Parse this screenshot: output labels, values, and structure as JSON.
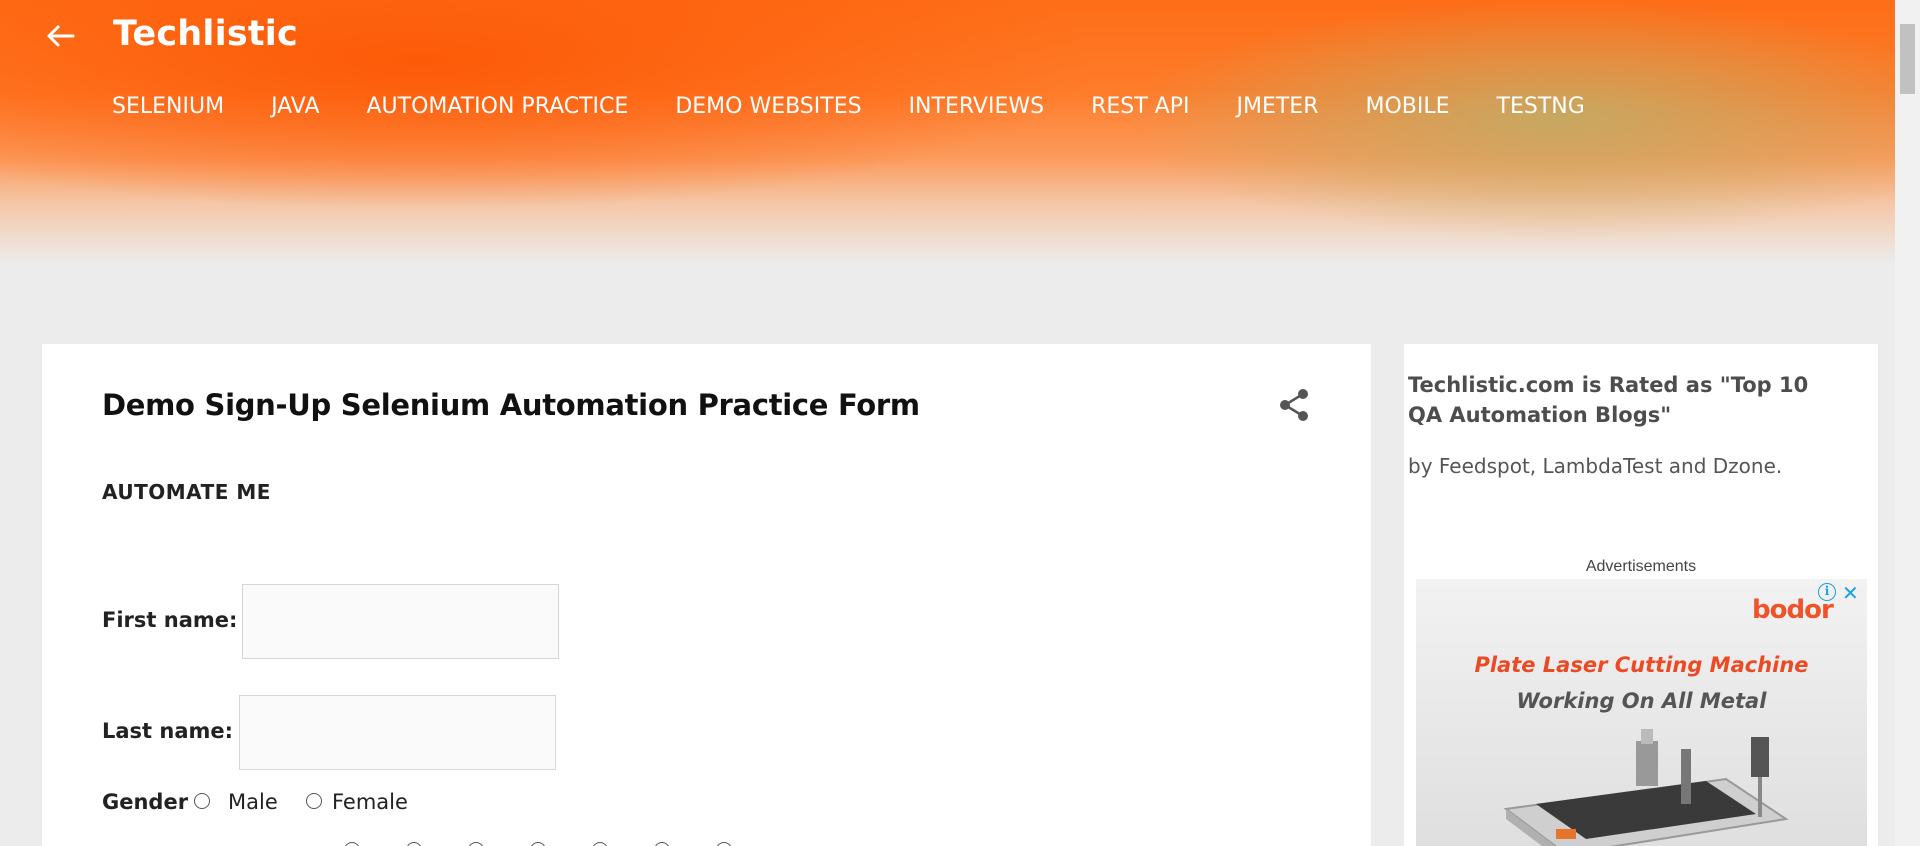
{
  "header": {
    "site_title": "Techlistic",
    "nav_items": [
      "SELENIUM",
      "JAVA",
      "AUTOMATION PRACTICE",
      "DEMO WEBSITES",
      "INTERVIEWS",
      "REST API",
      "JMETER",
      "MOBILE",
      "TESTNG"
    ]
  },
  "post": {
    "title": "Demo Sign-Up Selenium Automation Practice Form",
    "subheading": "AUTOMATE ME",
    "first_name_label": "First name:",
    "first_name_value": "",
    "last_name_label": "Last name:",
    "last_name_value": "",
    "gender_label": "Gender",
    "gender_options": [
      "Male",
      "Female"
    ]
  },
  "sidebar": {
    "rated_text": "Techlistic.com is Rated as \"Top 10 QA Automation Blogs\"",
    "by_text": "by Feedspot, LambdaTest and Dzone.",
    "ads_label": "Advertisements",
    "ad": {
      "brand": "bodor",
      "line1": "Plate Laser Cutting Machine",
      "line2": "Working On All Metal",
      "info_glyph": "i",
      "close_glyph": "✕"
    }
  },
  "icons": {
    "back": "arrow-left-icon",
    "share": "share-icon"
  },
  "colors": {
    "header_orange": "#fe6d17",
    "ad_accent": "#ea4b25",
    "ad_controls": "#1aa1e0"
  }
}
